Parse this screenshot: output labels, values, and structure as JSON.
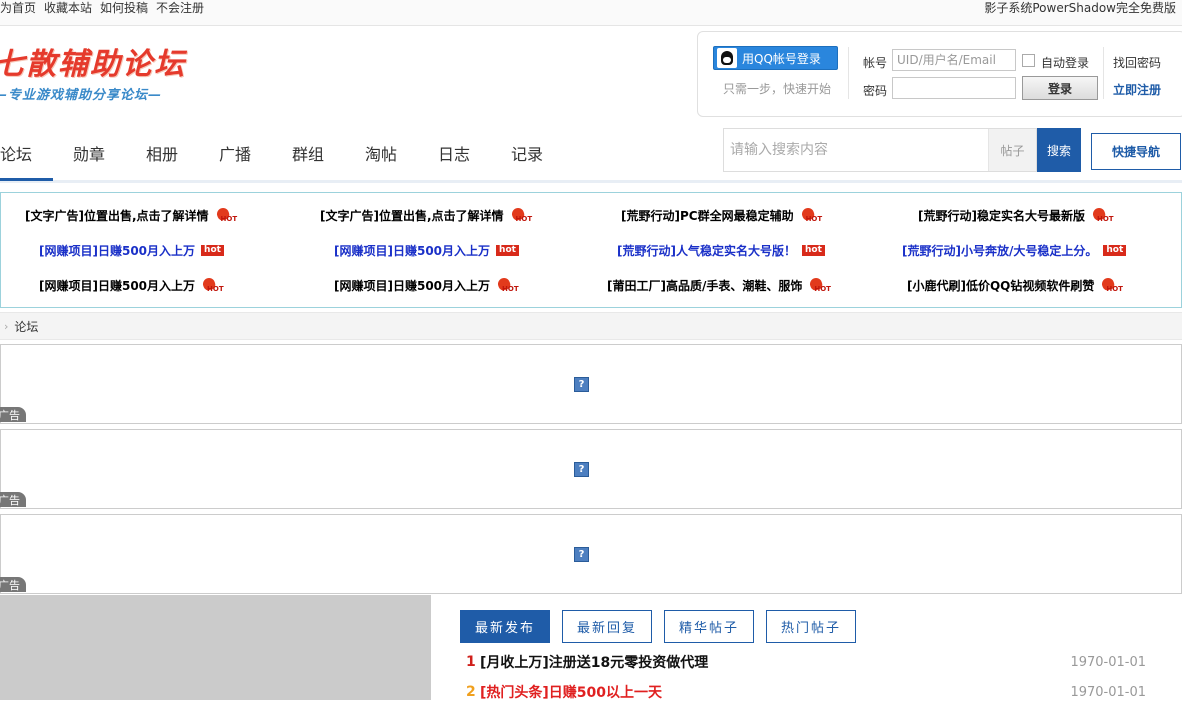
{
  "topbar": {
    "links": [
      "为首页",
      "收藏本站",
      "如何投稿",
      "不会注册"
    ],
    "right_text": "影子系统PowerShadow完全免费版"
  },
  "logo": {
    "title": "七散辅助论坛",
    "subtitle": "—专业游戏辅助分享论坛—"
  },
  "login": {
    "qq_button": "用QQ帐号登录",
    "qq_hint": "只需一步，快速开始",
    "account_label": "帐号",
    "account_placeholder": "UID/用户名/Email",
    "auto_login": "自动登录",
    "retrieve_password": "找回密码",
    "password_label": "密码",
    "login_button": "登录",
    "register": "立即注册"
  },
  "nav": {
    "items": [
      "论坛",
      "勋章",
      "相册",
      "广播",
      "群组",
      "淘帖",
      "日志",
      "记录"
    ],
    "active": "论坛",
    "search_placeholder": "请输入搜索内容",
    "search_type": "帖子",
    "search_button": "搜索",
    "quick_nav": "快捷导航"
  },
  "ads": [
    {
      "text": "[文字广告]位置出售,点击了解详情",
      "style": "black",
      "badge": "flame"
    },
    {
      "text": "[文字广告]位置出售,点击了解详情",
      "style": "black",
      "badge": "flame"
    },
    {
      "text": "[荒野行动]PC群全网最稳定辅助",
      "style": "black",
      "badge": "flame"
    },
    {
      "text": "[荒野行动]稳定实名大号最新版",
      "style": "black",
      "badge": "flame"
    },
    {
      "text": "[网赚项目]日赚500月入上万",
      "style": "blue",
      "badge": "box"
    },
    {
      "text": "[网赚项目]日赚500月入上万",
      "style": "blue",
      "badge": "box"
    },
    {
      "text": "[荒野行动]人气稳定实名大号版！",
      "style": "blue",
      "badge": "box"
    },
    {
      "text": "[荒野行动]小号奔放/大号稳定上分。",
      "style": "blue",
      "badge": "box"
    },
    {
      "text": "[网赚项目]日赚500月入上万",
      "style": "black",
      "badge": "flame"
    },
    {
      "text": "[网赚项目]日赚500月入上万",
      "style": "black",
      "badge": "flame"
    },
    {
      "text": "[莆田工厂]高品质/手表、潮鞋、服饰",
      "style": "black",
      "badge": "flame"
    },
    {
      "text": "[小鹿代刷]低价QQ钻视频软件刷赞",
      "style": "black",
      "badge": "flame"
    }
  ],
  "hot_box_label": "hot",
  "breadcrumb": {
    "current": "论坛"
  },
  "ad_slots": [
    {
      "mark": "?",
      "tag": "广告"
    },
    {
      "mark": "?",
      "tag": "广告"
    },
    {
      "mark": "?",
      "tag": "广告"
    }
  ],
  "posts": {
    "tabs": [
      "最新发布",
      "最新回复",
      "精华帖子",
      "热门帖子"
    ],
    "active_tab": "最新发布",
    "rows": [
      {
        "num": "1",
        "title": "[月收上万]注册送18元零投资做代理",
        "date": "1970-01-01",
        "num_color": "#d0201b",
        "title_color": "#111111"
      },
      {
        "num": "2",
        "title": "[热门头条]日赚500以上一天",
        "date": "1970-01-01",
        "num_color": "#f0a01e",
        "title_color": "#e02020"
      }
    ]
  }
}
